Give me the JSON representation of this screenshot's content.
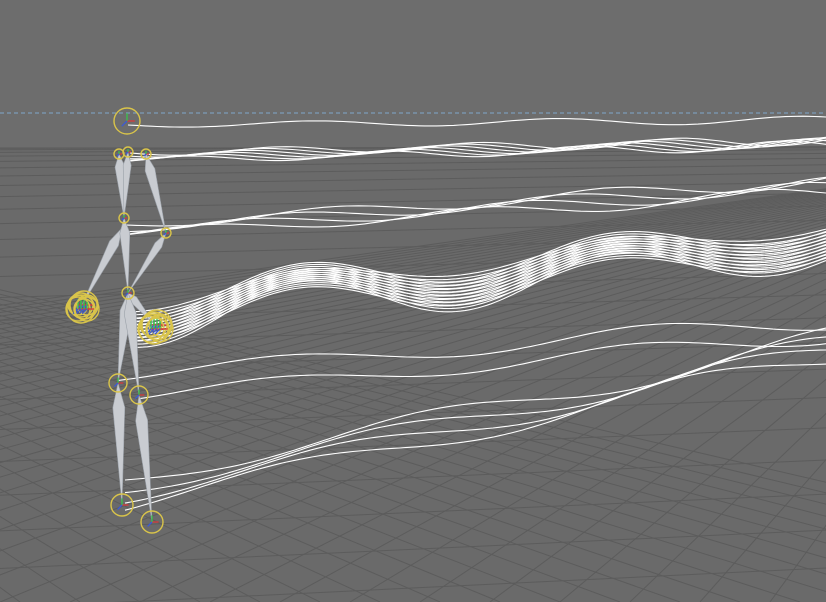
{
  "viewport": {
    "background": "#6b6b6b",
    "sky_color": "#6e6e6e",
    "grid_color": "#5a5a5a",
    "horizon_color": "#7aa0c8",
    "trail_color": "#ffffff",
    "bone_color": "#c8ccd2",
    "joint_ring_color": "#d8c44a"
  },
  "rig": {
    "name": "skeleton",
    "joints": [
      "head",
      "neck",
      "shoulder-l",
      "shoulder-r",
      "elbow-l",
      "elbow-r",
      "hand-l",
      "hand-r",
      "hip",
      "knee-l",
      "knee-r",
      "foot-l",
      "foot-r"
    ]
  },
  "icons": [
    "move-gizmo-icon",
    "joint-ring-icon"
  ]
}
